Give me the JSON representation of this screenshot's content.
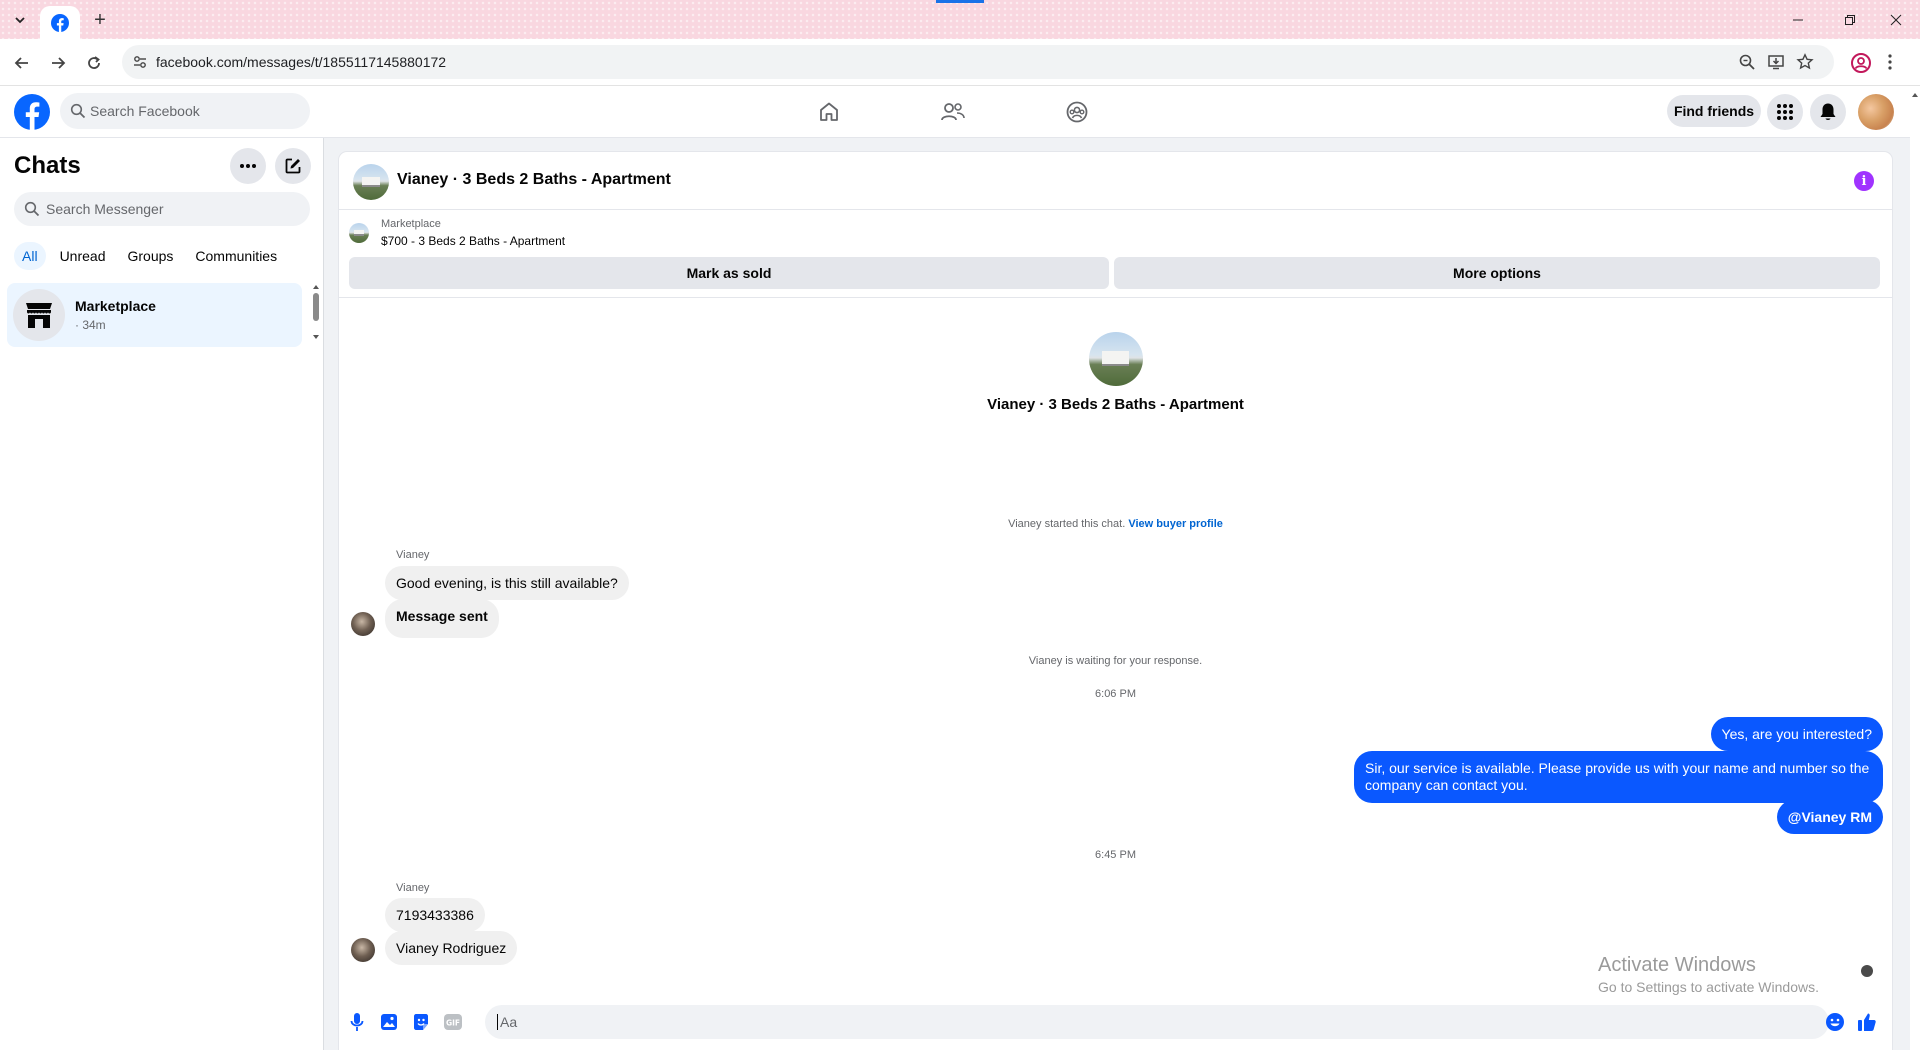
{
  "browser": {
    "url": "facebook.com/messages/t/1855117145880172",
    "new_tab_symbol": "+"
  },
  "topbar": {
    "search_placeholder": "Search Facebook",
    "find_friends": "Find friends"
  },
  "sidebar": {
    "title": "Chats",
    "search_placeholder": "Search Messenger",
    "filters": [
      "All",
      "Unread",
      "Groups",
      "Communities"
    ],
    "chats": [
      {
        "name": "Marketplace",
        "time": "· 34m"
      }
    ]
  },
  "conversation": {
    "title": "Vianey · 3 Beds 2 Baths - Apartment",
    "info_symbol": "i",
    "marketplace": {
      "label": "Marketplace",
      "listing": "$700 - 3 Beds 2 Baths - Apartment",
      "mark_sold": "Mark as sold",
      "more_options": "More options"
    },
    "profile_name": "Vianey · 3 Beds 2 Baths - Apartment",
    "started_text": "Vianey started this chat.",
    "view_buyer_profile": "View buyer profile",
    "messages_block1": {
      "sender": "Vianey",
      "msg1": "Good evening, is this still available?",
      "msg2": "Message sent"
    },
    "waiting_text": "Vianey is waiting for your response.",
    "time1": "6:06 PM",
    "outgoing": {
      "msg1": "Yes, are you interested?",
      "msg2": "Sir, our service is available. Please provide us with your name and number so the company can contact you.",
      "msg3": "@Vianey RM"
    },
    "time2": "6:45 PM",
    "messages_block2": {
      "sender": "Vianey",
      "msg1": "7193433386",
      "msg2": "Vianey Rodriguez"
    },
    "composer_placeholder": "Aa"
  },
  "watermark": {
    "line1": "Activate Windows",
    "line2": "Go to Settings to activate Windows."
  }
}
